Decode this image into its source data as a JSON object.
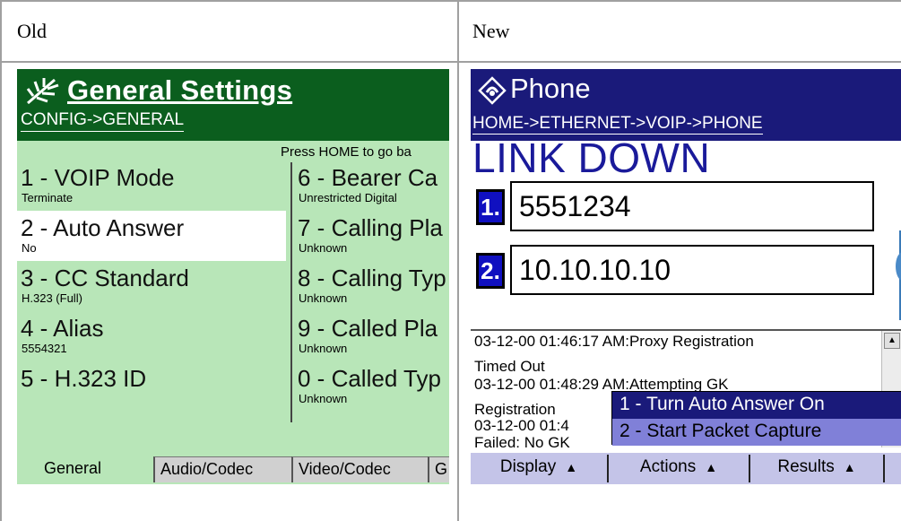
{
  "headers": {
    "old": "Old",
    "new": "New"
  },
  "old": {
    "title": "General Settings",
    "breadcrumb": "CONFIG->GENERAL",
    "hint": "Press HOME to go ba",
    "left_items": [
      {
        "label": "1 - VOIP Mode",
        "value": "Terminate"
      },
      {
        "label": "2 - Auto Answer",
        "value": "No"
      },
      {
        "label": "3 - CC Standard",
        "value": "H.323 (Full)"
      },
      {
        "label": "4 - Alias",
        "value": "5554321"
      },
      {
        "label": "5 - H.323 ID",
        "value": ""
      }
    ],
    "right_items": [
      {
        "label": "6 - Bearer Ca",
        "value": "Unrestricted Digital"
      },
      {
        "label": "7 - Calling Pla",
        "value": "Unknown"
      },
      {
        "label": "8 - Calling Typ",
        "value": "Unknown"
      },
      {
        "label": "9 - Called Pla",
        "value": "Unknown"
      },
      {
        "label": "0 - Called Typ",
        "value": "Unknown"
      }
    ],
    "tabs": [
      "General",
      "Audio/Codec",
      "Video/Codec",
      "G"
    ],
    "colors": {
      "titlebar": "#0b5e1e",
      "body": "#b8e6b8"
    }
  },
  "new": {
    "title": "Phone",
    "breadcrumb": "HOME->ETHERNET->VOIP->PHONE",
    "status": "LINK DOWN",
    "line1": {
      "num": "1.",
      "value": "5551234"
    },
    "line2": {
      "num": "2.",
      "value": "10.10.10.10"
    },
    "log": [
      "03-12-00 01:46:17 AM:Proxy Registration",
      "Timed Out",
      "03-12-00 01:48:29 AM:Attempting GK",
      "Registration",
      "03-12-00 01:4",
      "Failed: No GK"
    ],
    "menu": [
      "1 - Turn Auto Answer On",
      "2 - Start Packet Capture"
    ],
    "softkeys": [
      "Display",
      "Actions",
      "Results"
    ],
    "softkey_arrow": "▲",
    "colors": {
      "titlebar": "#1a1a7a",
      "status": "#1a1a9a",
      "menu_highlight": "#8080d8"
    }
  }
}
